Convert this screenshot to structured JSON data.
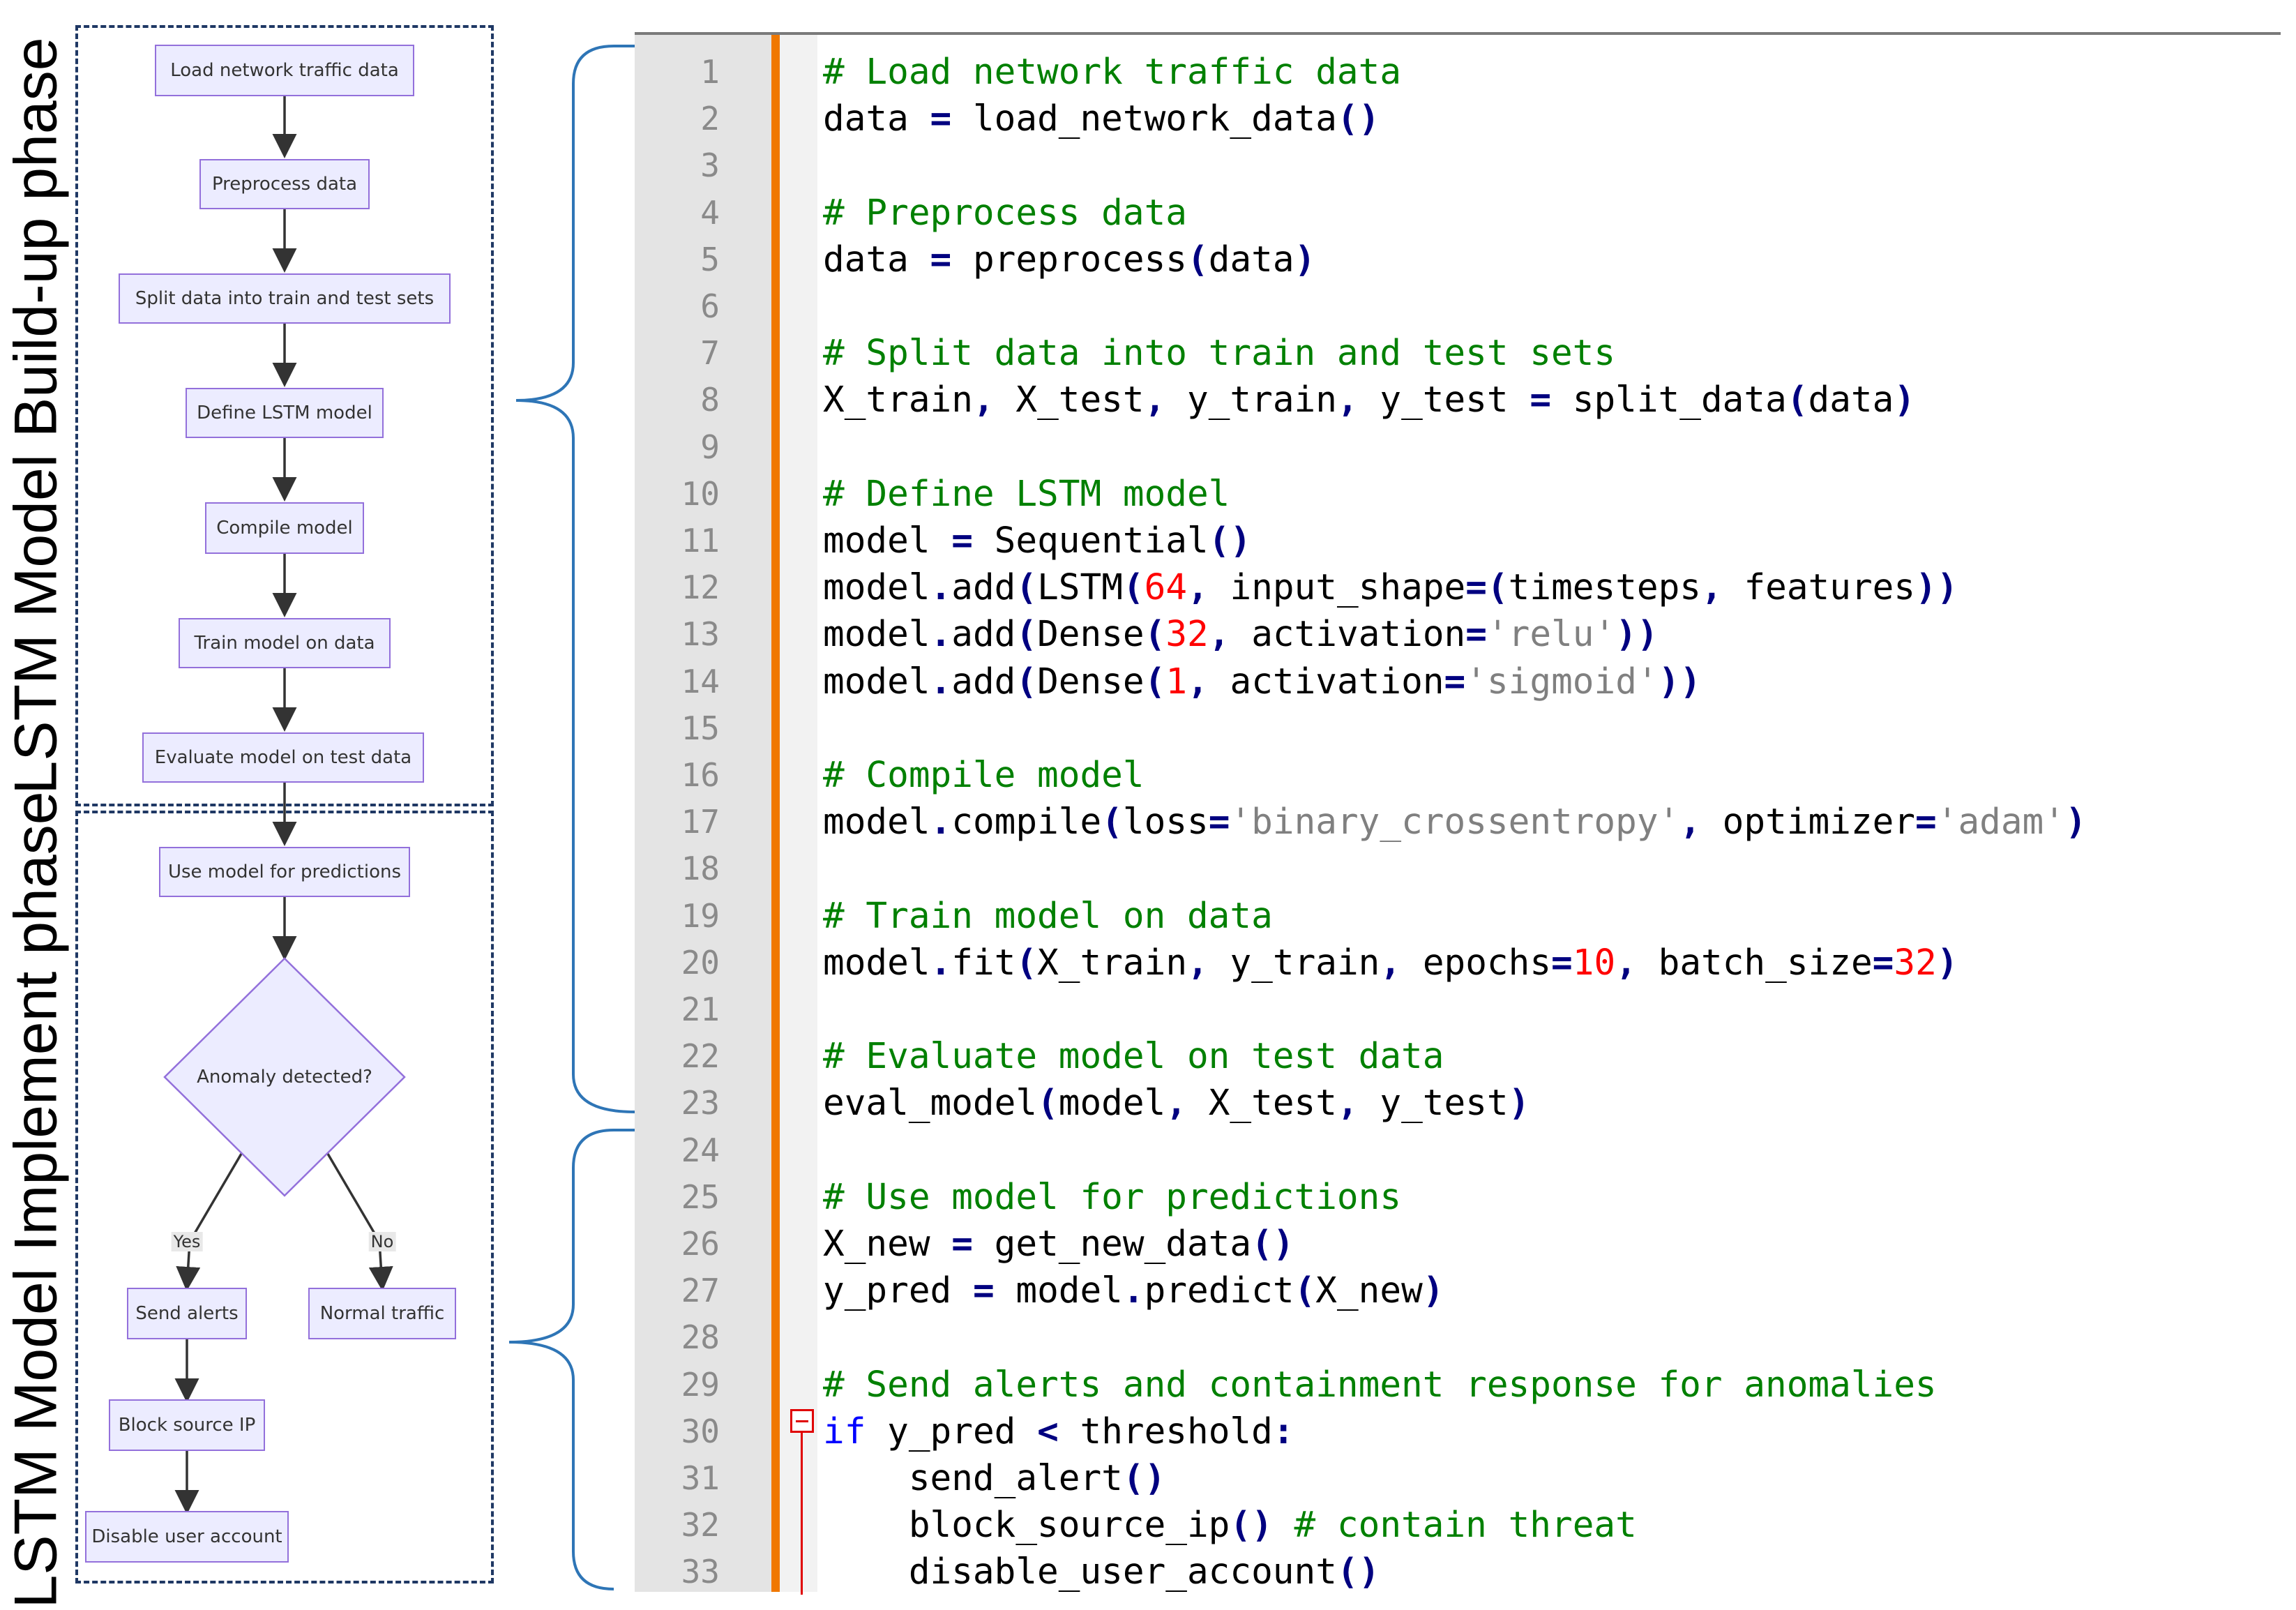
{
  "phases": {
    "build_up": "LSTM Model Build-up phase",
    "implement": "LSTM Model Implement phase"
  },
  "flow": {
    "load": "Load network traffic data",
    "preprocess": "Preprocess data",
    "split": "Split data into train and test sets",
    "define": "Define LSTM model",
    "compile": "Compile model",
    "train": "Train model on data",
    "evaluate": "Evaluate model on test data",
    "use": "Use model for predictions",
    "anomaly": "Anomaly detected?",
    "yes_label": "Yes",
    "no_label": "No",
    "send_alerts": "Send alerts",
    "normal": "Normal traffic",
    "block": "Block source IP",
    "disable": "Disable user account"
  },
  "colors": {
    "node_fill": "#ececff",
    "node_border": "#9370db",
    "phase_border": "#1f3864",
    "brace": "#2e75b6",
    "comment": "#008000",
    "keyword": "#0000ff",
    "number": "#ff0000",
    "string": "#808080",
    "fold_strip": "#f07800"
  },
  "code": {
    "lines": [
      [
        [
          "cm",
          "# Load network traffic data"
        ]
      ],
      [
        [
          "",
          "data "
        ],
        [
          "op",
          "="
        ],
        [
          "",
          " load_network_data"
        ],
        [
          "op",
          "()"
        ]
      ],
      [],
      [
        [
          "cm",
          "# Preprocess data"
        ]
      ],
      [
        [
          "",
          "data "
        ],
        [
          "op",
          "="
        ],
        [
          "",
          " preprocess"
        ],
        [
          "op",
          "("
        ],
        [
          "",
          "data"
        ],
        [
          "op",
          ")"
        ]
      ],
      [],
      [
        [
          "cm",
          "# Split data into train and test sets"
        ]
      ],
      [
        [
          "",
          "X_train"
        ],
        [
          "op",
          ","
        ],
        [
          "",
          " X_test"
        ],
        [
          "op",
          ","
        ],
        [
          "",
          " y_train"
        ],
        [
          "op",
          ","
        ],
        [
          "",
          " y_test "
        ],
        [
          "op",
          "="
        ],
        [
          "",
          " split_data"
        ],
        [
          "op",
          "("
        ],
        [
          "",
          "data"
        ],
        [
          "op",
          ")"
        ]
      ],
      [],
      [
        [
          "cm",
          "# Define LSTM model"
        ]
      ],
      [
        [
          "",
          "model "
        ],
        [
          "op",
          "="
        ],
        [
          "",
          " Sequential"
        ],
        [
          "op",
          "()"
        ]
      ],
      [
        [
          "",
          "model"
        ],
        [
          "op",
          "."
        ],
        [
          "",
          "add"
        ],
        [
          "op",
          "("
        ],
        [
          "",
          "LSTM"
        ],
        [
          "op",
          "("
        ],
        [
          "num",
          "64"
        ],
        [
          "op",
          ","
        ],
        [
          "",
          " input_shape"
        ],
        [
          "op",
          "=("
        ],
        [
          "",
          "timesteps"
        ],
        [
          "op",
          ","
        ],
        [
          "",
          " features"
        ],
        [
          "op",
          "))"
        ]
      ],
      [
        [
          "",
          "model"
        ],
        [
          "op",
          "."
        ],
        [
          "",
          "add"
        ],
        [
          "op",
          "("
        ],
        [
          "",
          "Dense"
        ],
        [
          "op",
          "("
        ],
        [
          "num",
          "32"
        ],
        [
          "op",
          ","
        ],
        [
          "",
          " activation"
        ],
        [
          "op",
          "="
        ],
        [
          "str",
          "'relu'"
        ],
        [
          "op",
          "))"
        ]
      ],
      [
        [
          "",
          "model"
        ],
        [
          "op",
          "."
        ],
        [
          "",
          "add"
        ],
        [
          "op",
          "("
        ],
        [
          "",
          "Dense"
        ],
        [
          "op",
          "("
        ],
        [
          "num",
          "1"
        ],
        [
          "op",
          ","
        ],
        [
          "",
          " activation"
        ],
        [
          "op",
          "="
        ],
        [
          "str",
          "'sigmoid'"
        ],
        [
          "op",
          "))"
        ]
      ],
      [],
      [
        [
          "cm",
          "# Compile model"
        ]
      ],
      [
        [
          "",
          "model"
        ],
        [
          "op",
          "."
        ],
        [
          "",
          "compile"
        ],
        [
          "op",
          "("
        ],
        [
          "",
          "loss"
        ],
        [
          "op",
          "="
        ],
        [
          "str",
          "'binary_crossentropy'"
        ],
        [
          "op",
          ","
        ],
        [
          "",
          " optimizer"
        ],
        [
          "op",
          "="
        ],
        [
          "str",
          "'adam'"
        ],
        [
          "op",
          ")"
        ]
      ],
      [],
      [
        [
          "cm",
          "# Train model on data"
        ]
      ],
      [
        [
          "",
          "model"
        ],
        [
          "op",
          "."
        ],
        [
          "",
          "fit"
        ],
        [
          "op",
          "("
        ],
        [
          "",
          "X_train"
        ],
        [
          "op",
          ","
        ],
        [
          "",
          " y_train"
        ],
        [
          "op",
          ","
        ],
        [
          "",
          " epochs"
        ],
        [
          "op",
          "="
        ],
        [
          "num",
          "10"
        ],
        [
          "op",
          ","
        ],
        [
          "",
          " batch_size"
        ],
        [
          "op",
          "="
        ],
        [
          "num",
          "32"
        ],
        [
          "op",
          ")"
        ]
      ],
      [],
      [
        [
          "cm",
          "# Evaluate model on test data"
        ]
      ],
      [
        [
          "",
          "eval_model"
        ],
        [
          "op",
          "("
        ],
        [
          "",
          "model"
        ],
        [
          "op",
          ","
        ],
        [
          "",
          " X_test"
        ],
        [
          "op",
          ","
        ],
        [
          "",
          " y_test"
        ],
        [
          "op",
          ")"
        ]
      ],
      [],
      [
        [
          "cm",
          "# Use model for predictions"
        ]
      ],
      [
        [
          "",
          "X_new "
        ],
        [
          "op",
          "="
        ],
        [
          "",
          " get_new_data"
        ],
        [
          "op",
          "()"
        ]
      ],
      [
        [
          "",
          "y_pred "
        ],
        [
          "op",
          "="
        ],
        [
          "",
          " model"
        ],
        [
          "op",
          "."
        ],
        [
          "",
          "predict"
        ],
        [
          "op",
          "("
        ],
        [
          "",
          "X_new"
        ],
        [
          "op",
          ")"
        ]
      ],
      [],
      [
        [
          "cm",
          "# Send alerts and containment response for anomalies"
        ]
      ],
      [
        [
          "kw",
          "if"
        ],
        [
          "",
          " y_pred "
        ],
        [
          "op",
          "<"
        ],
        [
          "",
          " threshold"
        ],
        [
          "op",
          ":"
        ]
      ],
      [
        [
          "",
          "    send_alert"
        ],
        [
          "op",
          "()"
        ]
      ],
      [
        [
          "",
          "    block_source_ip"
        ],
        [
          "op",
          "()"
        ],
        [
          "",
          " "
        ],
        [
          "cm",
          "# contain threat"
        ]
      ],
      [
        [
          "",
          "    disable_user_account"
        ],
        [
          "op",
          "()"
        ]
      ]
    ]
  }
}
